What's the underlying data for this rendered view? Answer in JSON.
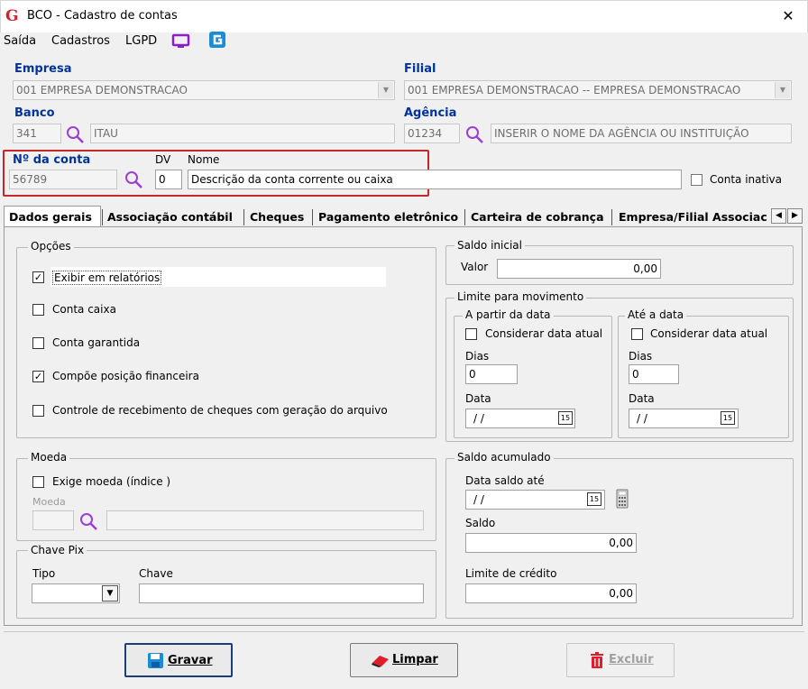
{
  "window": {
    "title": "BCO - Cadastro de contas",
    "logo": "G",
    "close": "✕"
  },
  "menu": {
    "items": [
      "Saída",
      "Cadastros",
      "LGPD"
    ]
  },
  "empresa": {
    "label": "Empresa",
    "value": "001 EMPRESA DEMONSTRACAO"
  },
  "filial": {
    "label": "Filial",
    "value": "001 EMPRESA DEMONSTRACAO -- EMPRESA DEMONSTRACAO"
  },
  "banco": {
    "label": "Banco",
    "code": "341",
    "name": "ITAU"
  },
  "agencia": {
    "label": "Agência",
    "code": "01234",
    "name": "INSERIR O NOME DA AGÊNCIA OU INSTITUIÇÃO"
  },
  "conta": {
    "label": "Nº da conta",
    "value": "56789",
    "dv_label": "DV",
    "dv": "0",
    "nome_label": "Nome",
    "nome": "Descrição da conta corrente ou caixa",
    "inativa_label": "Conta inativa"
  },
  "tabs": [
    "Dados gerais",
    "Associação contábil",
    "Cheques",
    "Pagamento eletrônico",
    "Carteira de cobrança",
    "Empresa/Filial Associac"
  ],
  "opcoes": {
    "title": "Opções",
    "items": [
      {
        "label": "Exibir em relatórios",
        "checked": true
      },
      {
        "label": "Conta caixa",
        "checked": false
      },
      {
        "label": "Conta garantida",
        "checked": false
      },
      {
        "label": "Compõe posição financeira",
        "checked": true
      },
      {
        "label": "Controle de recebimento de cheques com geração do arquivo",
        "checked": false
      }
    ]
  },
  "saldo_inicial": {
    "title": "Saldo inicial",
    "valor_label": "Valor",
    "valor": "0,00"
  },
  "limite": {
    "title": "Limite para movimento",
    "a_partir": {
      "title": "A partir da data",
      "considerar": "Considerar data atual",
      "dias_label": "Dias",
      "dias": "0",
      "data_label": "Data",
      "data": "/ /"
    },
    "ate": {
      "title": "Até a data",
      "considerar": "Considerar data atual",
      "dias_label": "Dias",
      "dias": "0",
      "data_label": "Data",
      "data": "/ /"
    }
  },
  "moeda": {
    "title": "Moeda",
    "exige": "Exige moeda (índice )",
    "field_label": "Moeda"
  },
  "pix": {
    "title": "Chave Pix",
    "tipo_label": "Tipo",
    "chave_label": "Chave"
  },
  "saldo_acum": {
    "title": "Saldo acumulado",
    "data_label": "Data saldo até",
    "data": "/ /",
    "saldo_label": "Saldo",
    "saldo": "0,00",
    "limite_label": "Limite de crédito",
    "limite": "0,00"
  },
  "buttons": {
    "gravar": "Gravar",
    "limpar": "Limpar",
    "excluir": "Excluir"
  },
  "cal_label": "15",
  "colors": {
    "label_blue": "#003399",
    "highlight_red": "#c42727",
    "logo_red": "#d3202a",
    "magnifier": "#9b3fd0"
  }
}
